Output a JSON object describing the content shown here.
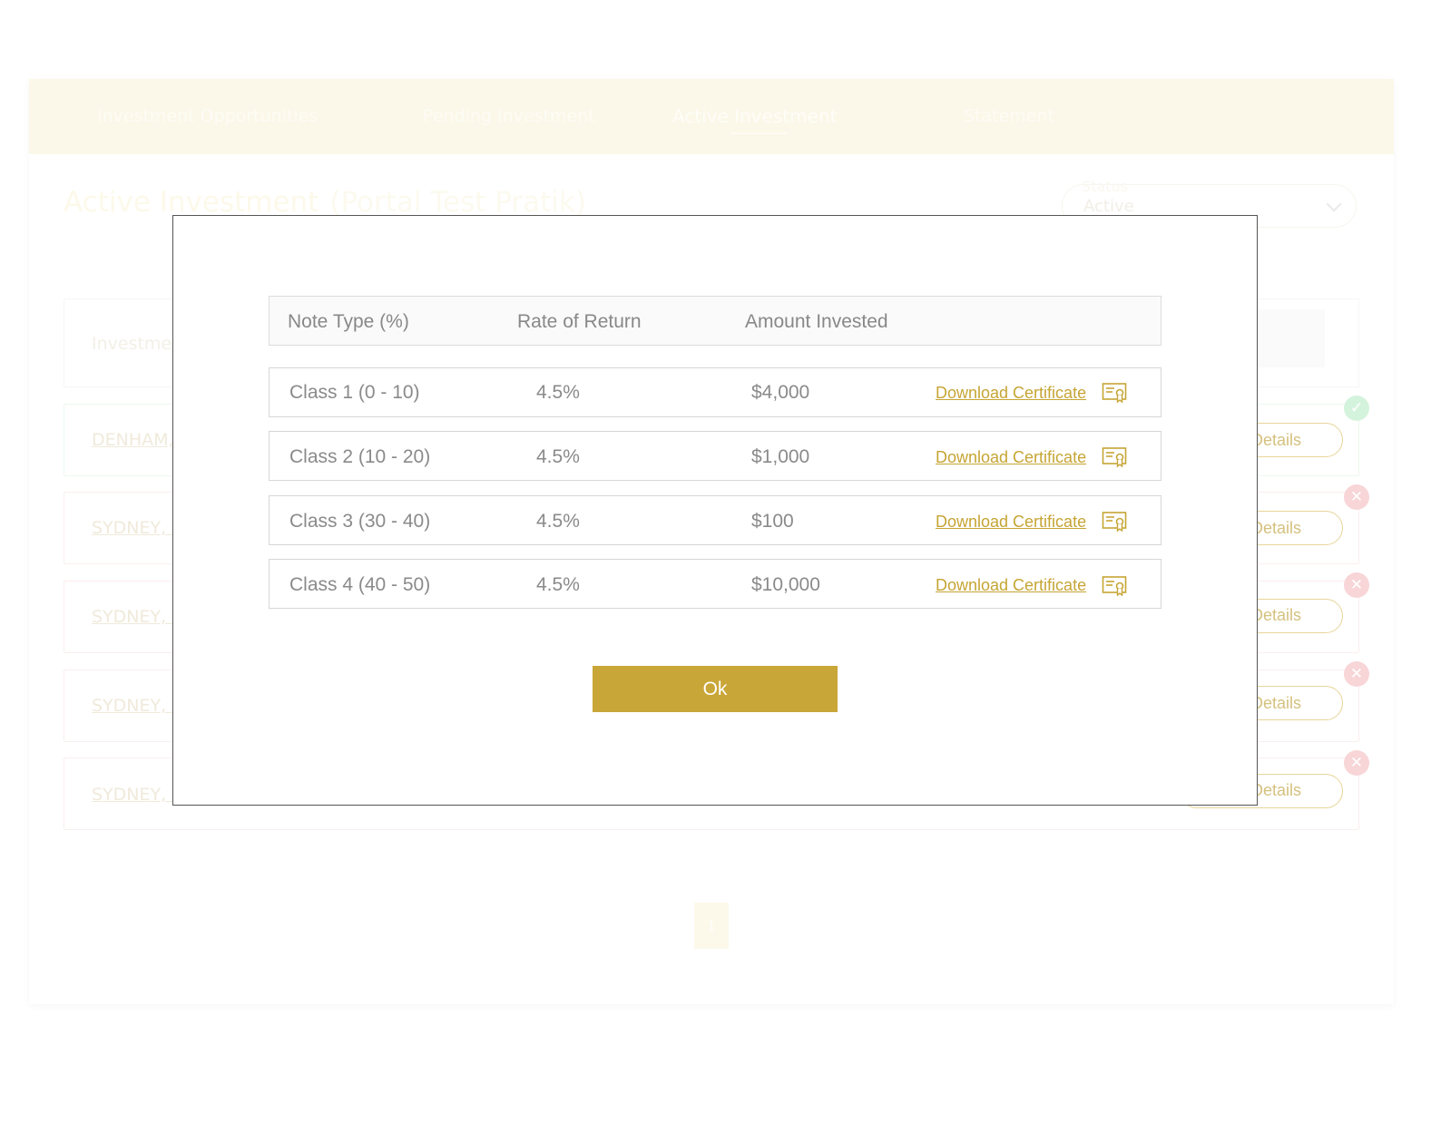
{
  "nav": {
    "items": [
      "Investment Opportunities",
      "Pending Investment",
      "Active Investment",
      "Statement"
    ]
  },
  "background": {
    "title": "Active Investment",
    "subtitle": "(Portal Test Pratik)",
    "status_label": "Status",
    "status_value": "Active",
    "header_label": "Investme",
    "rows": [
      {
        "link": "DENHAM,",
        "status": "active"
      },
      {
        "link": "SYDNEY, I",
        "status": "inactive"
      },
      {
        "link": "SYDNEY, I",
        "status": "inactive"
      },
      {
        "link": "SYDNEY, I",
        "status": "inactive"
      },
      {
        "link": "SYDNEY, I",
        "status": "inactive"
      }
    ],
    "details_label": "Details",
    "page_number": "1",
    "colors": {
      "accent": "#c9a638",
      "success": "#28c160",
      "error": "#e03c46"
    }
  },
  "modal": {
    "columns": [
      "Note Type (%)",
      "Rate of Return",
      "Amount Invested"
    ],
    "rows": [
      {
        "note_type": "Class 1 (0 - 10)",
        "rate": "4.5%",
        "amount": "$4,000",
        "action": "Download Certificate",
        "icon": "certificate-icon"
      },
      {
        "note_type": "Class 2 (10 - 20)",
        "rate": "4.5%",
        "amount": "$1,000",
        "action": "Download Certificate",
        "icon": "certificate-icon"
      },
      {
        "note_type": "Class 3 (30 - 40)",
        "rate": "4.5%",
        "amount": "$100",
        "action": "Download Certificate",
        "icon": "certificate-icon"
      },
      {
        "note_type": "Class 4 (40 - 50)",
        "rate": "4.5%",
        "amount": "$10,000",
        "action": "Download Certificate",
        "icon": "certificate-icon"
      }
    ],
    "ok_label": "Ok"
  }
}
